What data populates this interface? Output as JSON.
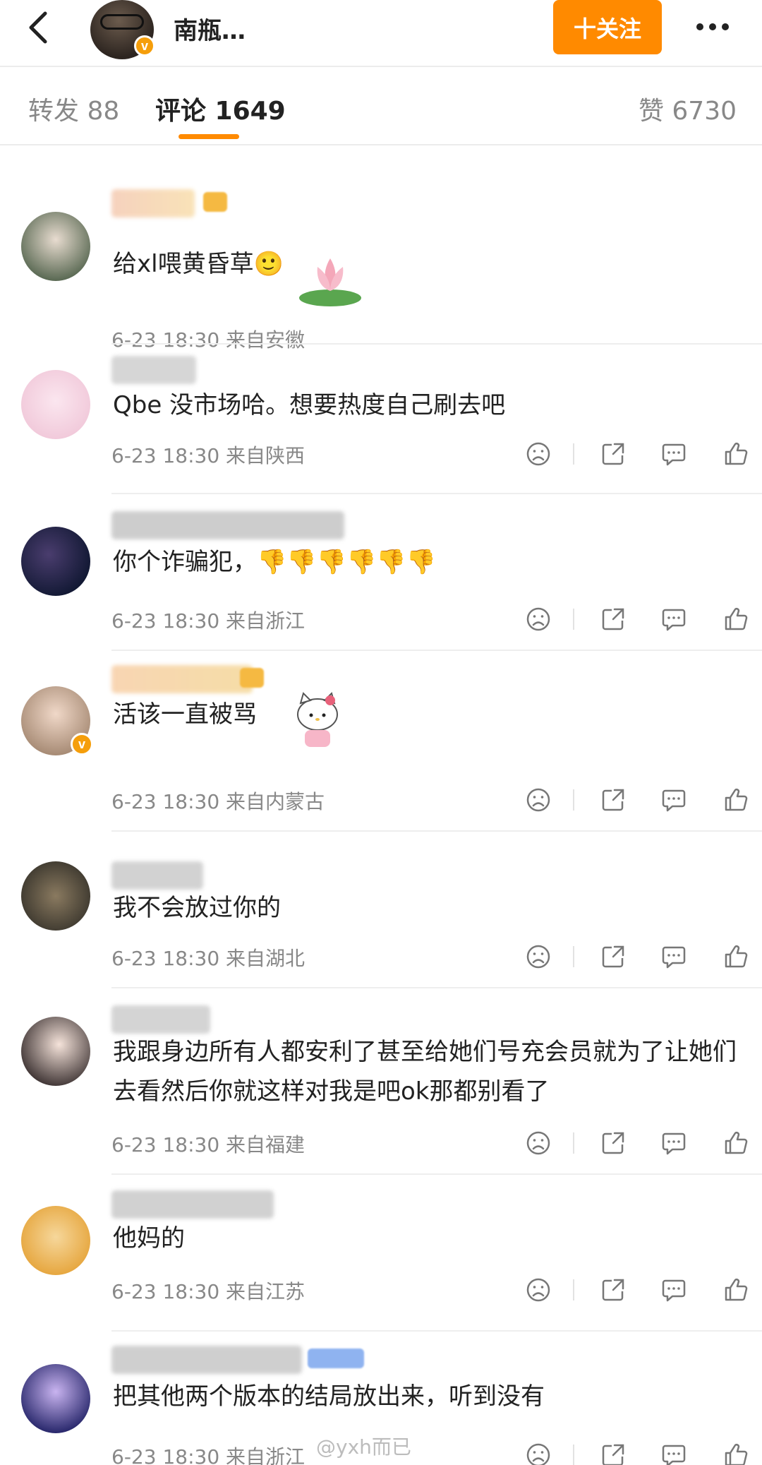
{
  "header": {
    "author_name": "南瓶…",
    "follow_label": "十关注"
  },
  "tabs": {
    "repost": "转发 88",
    "comment": "评论 1649",
    "likes": "赞 6730"
  },
  "comments": [
    {
      "text": "给xl喂黄昏草🙂",
      "meta": "6-23 18:30 来自安徽",
      "verified": false
    },
    {
      "text": "Qbe 没市场哈。想要热度自己刷去吧",
      "meta": "6-23 18:30 来自陕西",
      "verified": false
    },
    {
      "text": "你个诈骗犯，👎👎👎👎👎👎",
      "meta": "6-23 18:30 来自浙江",
      "verified": false
    },
    {
      "text": "活该一直被骂",
      "meta": "6-23 18:30 来自内蒙古",
      "verified": true
    },
    {
      "text": "我不会放过你的",
      "meta": "6-23 18:30 来自湖北",
      "verified": false
    },
    {
      "text": "我跟身边所有人都安利了甚至给她们号充会员就为了让她们去看然后你就这样对我是吧ok那都别看了",
      "meta": "6-23 18:30 来自福建",
      "verified": false
    },
    {
      "text": "他妈的",
      "meta": "6-23 18:30 来自江苏",
      "verified": false
    },
    {
      "text": "把其他两个版本的结局放出来，听到没有",
      "meta": "6-23 18:30 来自浙江",
      "verified": false
    }
  ],
  "watermark": "@yxh而已",
  "icons": {
    "back": "chevron-left-icon",
    "more": "more-dots-icon",
    "sad": "sad-face-icon",
    "share": "share-icon",
    "reply": "reply-bubble-icon",
    "like": "thumbs-up-icon",
    "verified": "verified-badge-icon"
  },
  "colors": {
    "accent": "#ff8a00",
    "muted": "#888888"
  }
}
